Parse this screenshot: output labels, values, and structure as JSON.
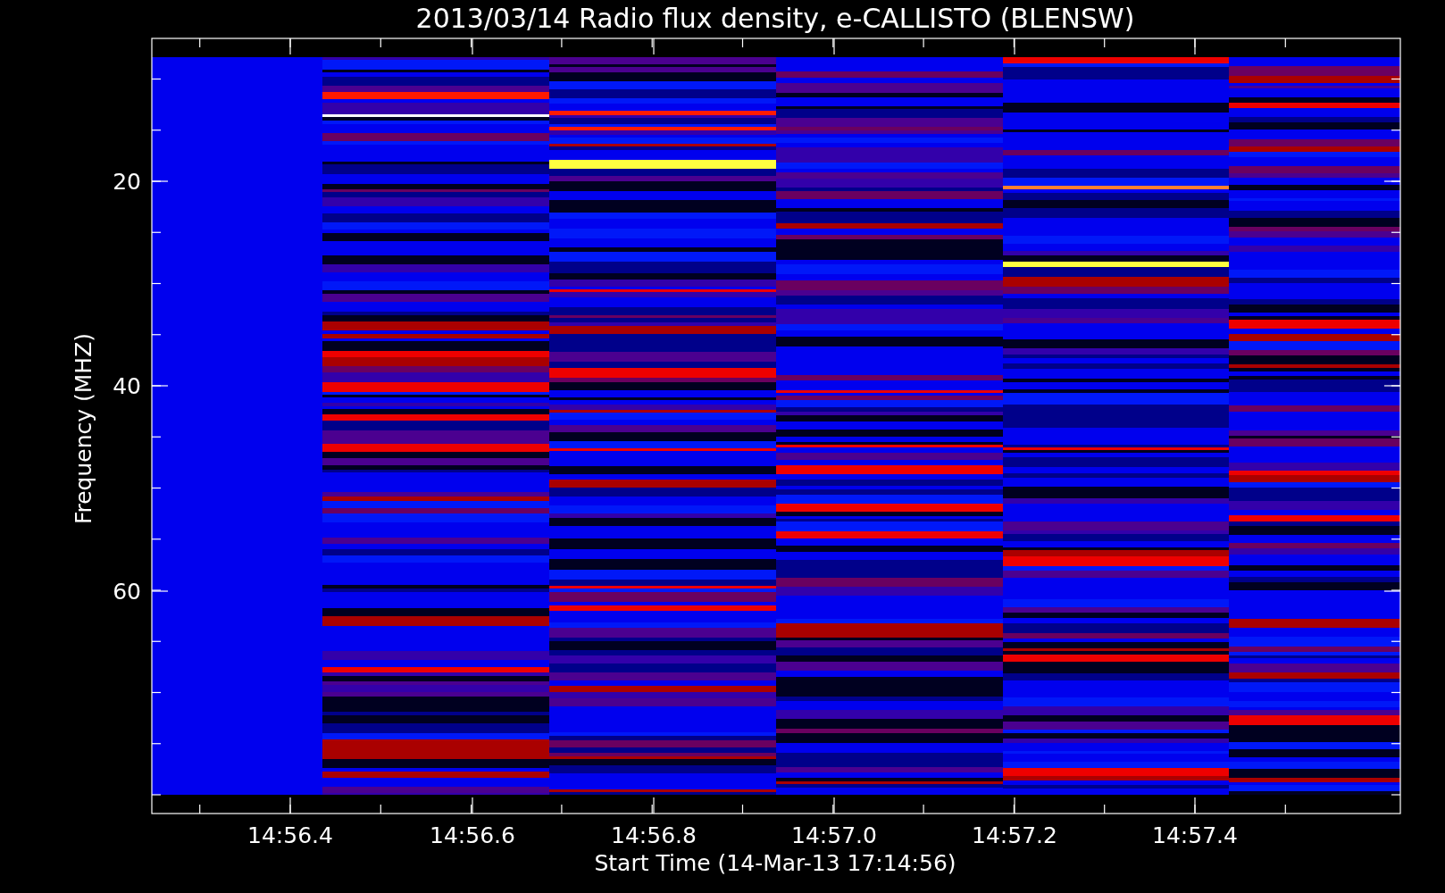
{
  "title": "2013/03/14  Radio flux density, e-CALLISTO (BLENSW)",
  "y_axis": {
    "label": "Frequency (MHZ)",
    "ticks": [
      "20",
      "40",
      "60"
    ]
  },
  "x_axis": {
    "label": "Start Time (14-Mar-13 17:14:56)",
    "ticks": [
      "14:56.4",
      "14:56.6",
      "14:56.8",
      "14:57.0",
      "14:57.2",
      "14:57.4"
    ]
  }
}
